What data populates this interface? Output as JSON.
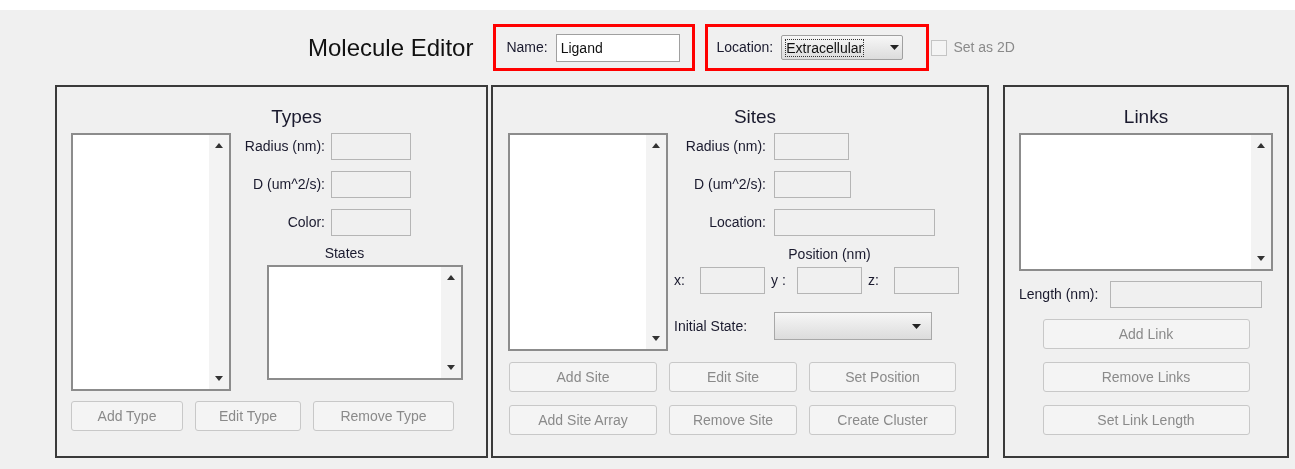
{
  "title": "Molecule Editor",
  "name_field": {
    "label": "Name:",
    "value": "Ligand",
    "highlighted": true
  },
  "location_field": {
    "label": "Location:",
    "value": "Extracellular",
    "highlighted": true
  },
  "set_as_2d": {
    "label": "Set as 2D",
    "checked": false,
    "disabled": true
  },
  "types": {
    "title": "Types",
    "fields": [
      {
        "label": "Radius (nm):"
      },
      {
        "label": "D (um^2/s):"
      },
      {
        "label": "Color:"
      }
    ],
    "states_label": "States",
    "buttons": [
      {
        "label": "Add Type",
        "disabled": true
      },
      {
        "label": "Edit Type",
        "disabled": true
      },
      {
        "label": "Remove Type",
        "disabled": true
      }
    ]
  },
  "sites": {
    "title": "Sites",
    "fields": [
      {
        "label": "Radius (nm):"
      },
      {
        "label": "D (um^2/s):"
      },
      {
        "label": "Location:"
      }
    ],
    "position_label": "Position (nm)",
    "coords": [
      {
        "label": "x:"
      },
      {
        "label": "y :"
      },
      {
        "label": "z:"
      }
    ],
    "initial_state_label": "Initial State:",
    "buttons": [
      {
        "label": "Add Site",
        "disabled": true
      },
      {
        "label": "Edit Site",
        "disabled": true
      },
      {
        "label": "Set Position",
        "disabled": true
      },
      {
        "label": "Add Site Array",
        "disabled": true
      },
      {
        "label": "Remove Site",
        "disabled": true
      },
      {
        "label": "Create Cluster",
        "disabled": true
      }
    ]
  },
  "links": {
    "title": "Links",
    "length_label": "Length (nm):",
    "buttons": [
      {
        "label": "Add Link",
        "disabled": true
      },
      {
        "label": "Remove Links",
        "disabled": true
      },
      {
        "label": "Set Link Length",
        "disabled": true
      }
    ]
  }
}
